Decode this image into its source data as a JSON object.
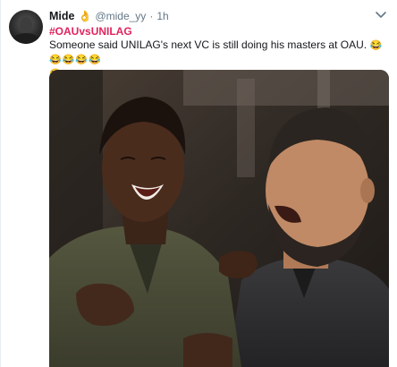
{
  "tweet": {
    "author_name": "Mide",
    "author_emoji": "👌",
    "handle": "@mide_yy",
    "separator": "·",
    "time": "1h",
    "hashtag": "#OAUvsUNILAG",
    "text": "Someone said UNILAG's next VC is still doing his masters at OAU.",
    "reaction_emojis": [
      "😂",
      "😂",
      "😂",
      "😂",
      "😂",
      "😂"
    ]
  },
  "icons": {
    "menu": "chevron-down-icon",
    "avatar": "avatar"
  },
  "colors": {
    "hashtag": "#e0245e",
    "handle": "#657786",
    "text": "#14171a"
  }
}
